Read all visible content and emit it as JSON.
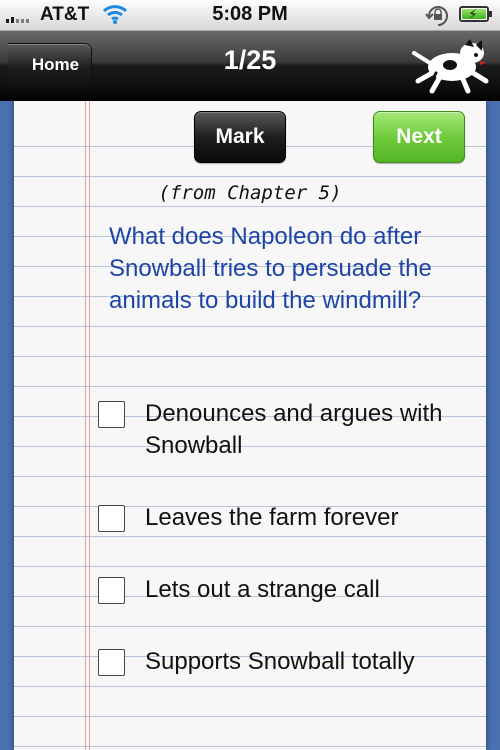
{
  "status_bar": {
    "carrier": "AT&T",
    "time": "5:08 PM",
    "icons": [
      "signal-icon",
      "wifi-icon",
      "orientation-lock-icon",
      "battery-charging-icon"
    ]
  },
  "nav": {
    "back_label": "Home",
    "title": "1/25",
    "logo_icon": "dog-logo-icon"
  },
  "quiz": {
    "mark_label": "Mark",
    "next_label": "Next",
    "chapter": "(from Chapter 5)",
    "question": "What does Napoleon do after Snowball tries to persuade the animals to build the windmill?",
    "options": [
      {
        "label": "Denounces and argues with Snowball",
        "checked": false
      },
      {
        "label": "Leaves the farm forever",
        "checked": false
      },
      {
        "label": "Lets out a strange call",
        "checked": false
      },
      {
        "label": "Supports Snowball totally",
        "checked": false
      }
    ]
  },
  "colors": {
    "question_text": "#1d44a6",
    "next_button": "#6fcc3c",
    "mark_button": "#1f1f1f",
    "background": "#4a70b0",
    "paper_margin": "#e8a0a0"
  }
}
